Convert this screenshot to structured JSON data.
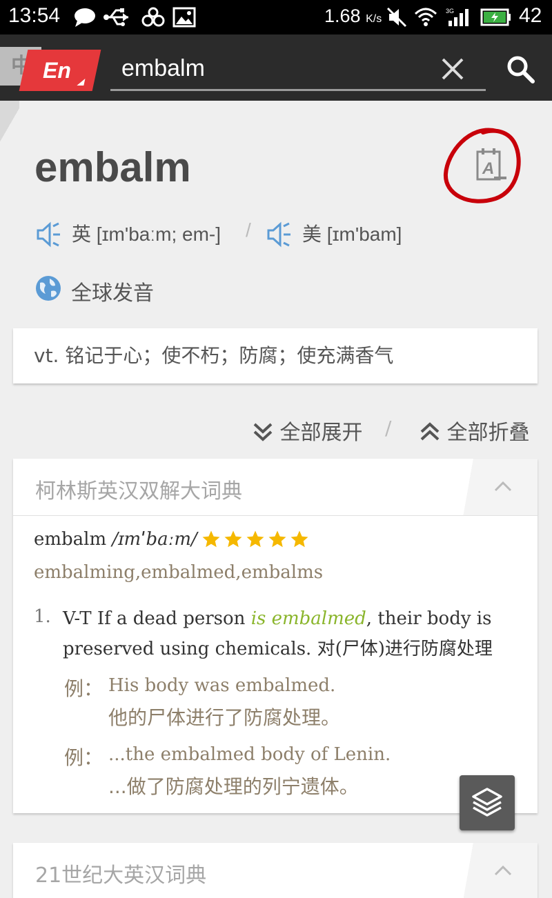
{
  "status_bar": {
    "time": "13:54",
    "speed": "1.68",
    "speed_unit": "K/s",
    "battery": "42"
  },
  "app_bar": {
    "lang_zh": "中",
    "lang_en": "En",
    "search_value": "embalm"
  },
  "word": "embalm",
  "pronunciation": {
    "uk_label": "英",
    "uk_phonetic": "[ɪm'baːm; em-]",
    "separator": "/",
    "us_label": "美",
    "us_phonetic": "[ɪm'bam]",
    "global_label": "全球发音"
  },
  "brief_definition": "vt. 铭记于心；使不朽；防腐；使充满香气",
  "controls": {
    "expand_all": "全部展开",
    "separator": "/",
    "collapse_all": "全部折叠"
  },
  "collins": {
    "title": "柯林斯英汉双解大词典",
    "entry_word": "embalm",
    "entry_phonetic": "/ɪmˈbaːm/",
    "stars": 5,
    "forms": "embalming,embalmed,embalms",
    "sense_number": "1.",
    "sense_pre": "V-T If a dead person ",
    "sense_highlight": "is embalmed",
    "sense_post": ", their body is preserved using chemicals. 对(尸体)进行防腐处理",
    "examples": [
      {
        "label": "例：",
        "en": "His body was embalmed.",
        "cn": "他的尸体进行了防腐处理。"
      },
      {
        "label": "例：",
        "en": "...the embalmed body of Lenin.",
        "cn": "...做了防腐处理的列宁遗体。"
      }
    ]
  },
  "century21": {
    "title": "21世纪大英汉词典"
  },
  "colors": {
    "accent_red": "#e5383b",
    "highlight_green": "#8ab52b",
    "speaker_blue": "#5b9bd5",
    "star_gold": "#f5b800"
  }
}
